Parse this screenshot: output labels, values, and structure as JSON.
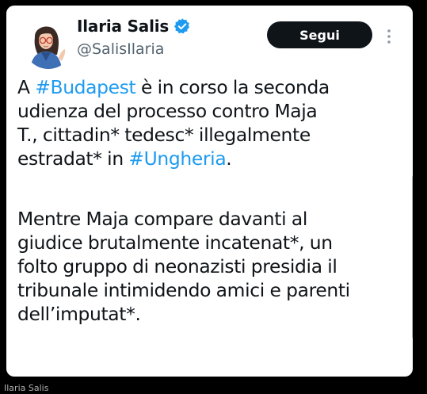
{
  "tweet": {
    "author_name": "Ilaria Salis",
    "verified": true,
    "handle": "@SalisIlaria",
    "follow_label": "Segui",
    "more_icon": "more-vertical-icon",
    "avatar_icon": "user-avatar",
    "paragraph1": {
      "line1_prefix": "A ",
      "hashtag_budapest": "#Budapest",
      "line1_suffix": " è in corso la seconda",
      "line2": "udienza del processo contro Maja",
      "line3": "T., cittadin* tedesc* illegalmente",
      "line4_prefix": "estradat* in ",
      "hashtag_ungheria": "#Ungheria",
      "line4_suffix": "."
    },
    "paragraph2": {
      "line1": "Mentre Maja compare davanti al",
      "line2": "giudice brutalmente incatenat*, un",
      "line3": "folto gruppo di neonazisti presidia il",
      "line4": "tribunale intimidendo amici e parenti",
      "line5": "dell’imputat*."
    }
  },
  "caption": "Ilaria Salis",
  "colors": {
    "hashtag": "#1d9bf0",
    "verified_badge": "#1d9bf0",
    "text": "#0f1419",
    "muted": "#536471",
    "follow_bg": "#0f1419"
  }
}
